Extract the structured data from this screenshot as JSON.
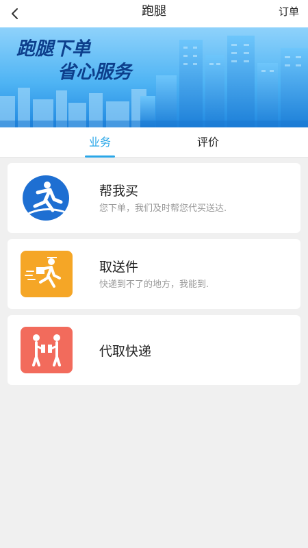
{
  "header": {
    "title": "跑腿",
    "orders_label": "订单"
  },
  "banner": {
    "line1": "跑腿下单",
    "line2": "省心服务"
  },
  "tabs": [
    {
      "label": "业务",
      "active": true
    },
    {
      "label": "评价",
      "active": false
    }
  ],
  "services": [
    {
      "title": "帮我买",
      "desc": "您下单，我们及时帮您代买送达.",
      "icon": "running-person-icon",
      "color": "#1e6fd2"
    },
    {
      "title": "取送件",
      "desc": "快递到不了的地方，我能到.",
      "icon": "courier-icon",
      "color": "#f5a626"
    },
    {
      "title": "代取快递",
      "desc": "",
      "icon": "package-handoff-icon",
      "color": "#f26b5c"
    }
  ],
  "colors": {
    "accent": "#2aa7e8",
    "banner_sky": "#3da8f2"
  }
}
